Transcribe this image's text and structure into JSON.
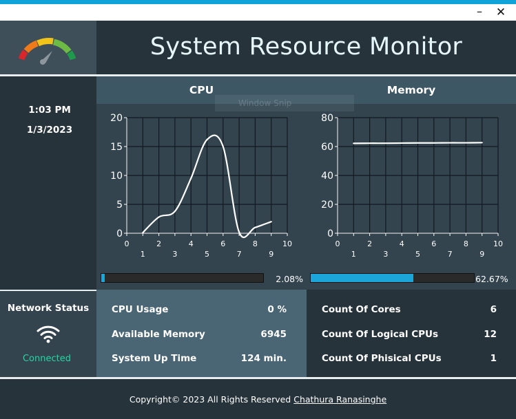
{
  "window": {
    "minimize_glyph": "–",
    "close_glyph": "✕"
  },
  "header": {
    "title": "System Resource Monitor",
    "logo_icon": "gauge-icon"
  },
  "clock": {
    "time": "1:03 PM",
    "date": "1/3/2023"
  },
  "cpu": {
    "title": "CPU",
    "progress_label": "2.08%",
    "progress_fraction": 0.0208
  },
  "memory": {
    "title": "Memory",
    "progress_label": "62.67%",
    "progress_fraction": 0.6267
  },
  "overlay": {
    "ghost_text": "Window Snip"
  },
  "network": {
    "title": "Network Status",
    "status": "Connected",
    "icon": "wifi-icon",
    "status_color": "#23d7a4"
  },
  "stats_cpu": [
    {
      "label": "CPU Usage",
      "value": "0 %"
    },
    {
      "label": "Available Memory",
      "value": "6945"
    },
    {
      "label": "System Up Time",
      "value": "124 min."
    }
  ],
  "stats_mem": [
    {
      "label": "Count Of Cores",
      "value": "6"
    },
    {
      "label": "Count Of Logical CPUs",
      "value": "12"
    },
    {
      "label": "Count Of Phisical CPUs",
      "value": "1"
    }
  ],
  "footer": {
    "text": "Copyright© 2023 All Rights Reserved",
    "author": "Chathura Ranasinghe"
  },
  "colors": {
    "accent": "#1ba5d8",
    "dark": "#27333b",
    "panel": "#33444f",
    "header_panel": "#3e5764"
  },
  "chart_data": [
    {
      "type": "line",
      "name": "cpu",
      "x": [
        1,
        2,
        3,
        4,
        5,
        6,
        7,
        8,
        9
      ],
      "values": [
        0.1,
        2.8,
        3.8,
        9.5,
        16.2,
        15.0,
        0.2,
        1.0,
        2.0
      ],
      "xlim": [
        0,
        10
      ],
      "ylim": [
        0,
        20
      ],
      "xticks": [
        0,
        1,
        2,
        3,
        4,
        5,
        6,
        7,
        8,
        9,
        10
      ],
      "yticks": [
        0,
        5,
        10,
        15,
        20
      ],
      "grid": true
    },
    {
      "type": "line",
      "name": "memory",
      "x": [
        1,
        2,
        3,
        4,
        5,
        6,
        7,
        8,
        9
      ],
      "values": [
        62.2,
        62.3,
        62.3,
        62.4,
        62.5,
        62.5,
        62.6,
        62.6,
        62.7
      ],
      "xlim": [
        0,
        10
      ],
      "ylim": [
        0,
        80
      ],
      "xticks": [
        0,
        1,
        2,
        3,
        4,
        5,
        6,
        7,
        8,
        9,
        10
      ],
      "yticks": [
        0,
        20,
        40,
        60,
        80
      ],
      "grid": true
    }
  ]
}
